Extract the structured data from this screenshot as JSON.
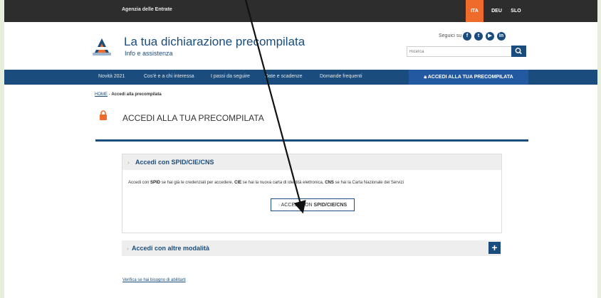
{
  "topbar": {
    "agency": "Agenzia delle Entrate",
    "languages": [
      "ITA",
      "DEU",
      "SLO"
    ],
    "active_language": "ITA",
    "accent_color": "#ee6b2b"
  },
  "header": {
    "title": "La tua dichiarazione precompilata",
    "subtitle": "Info e assistenza",
    "follow_text": "Seguici su",
    "social_icons": [
      "facebook-icon",
      "twitter-icon",
      "youtube-icon",
      "linkedin-icon"
    ],
    "search_placeholder": "Ricerca"
  },
  "nav": {
    "items": [
      "Novità 2021",
      "Cos'è e a chi interessa",
      "I passi da seguire",
      "Date e scadenze",
      "Domande frequenti"
    ],
    "cta": "ACCEDI ALLA TUA PRECOMPILATA",
    "color": "#1a4d7d"
  },
  "breadcrumb": {
    "home": "HOME",
    "separator": " - ",
    "current": "Accedi alla precompilata"
  },
  "page": {
    "title": "ACCEDI ALLA TUA PRECOMPILATA"
  },
  "panel_spid": {
    "title": "Accedi con SPID/CIE/CNS",
    "desc": {
      "p1": "Accedi con ",
      "b1": "SPID",
      "p2": " se hai già le credenziali per accedere, ",
      "b2": "CIE",
      "p3": " se hai la nuova carta di identità elettronica, ",
      "b3": "CNS",
      "p4": " se hai la Carta Nazionale dei Servizi"
    },
    "button_prefix": "ACCEDI CON ",
    "button_bold": "SPID/CIE/CNS"
  },
  "panel_other": {
    "title": "Accedi con altre modalità",
    "expand_symbol": "+"
  },
  "footer_link": "Verifica se hai bisogno di abilitarti"
}
